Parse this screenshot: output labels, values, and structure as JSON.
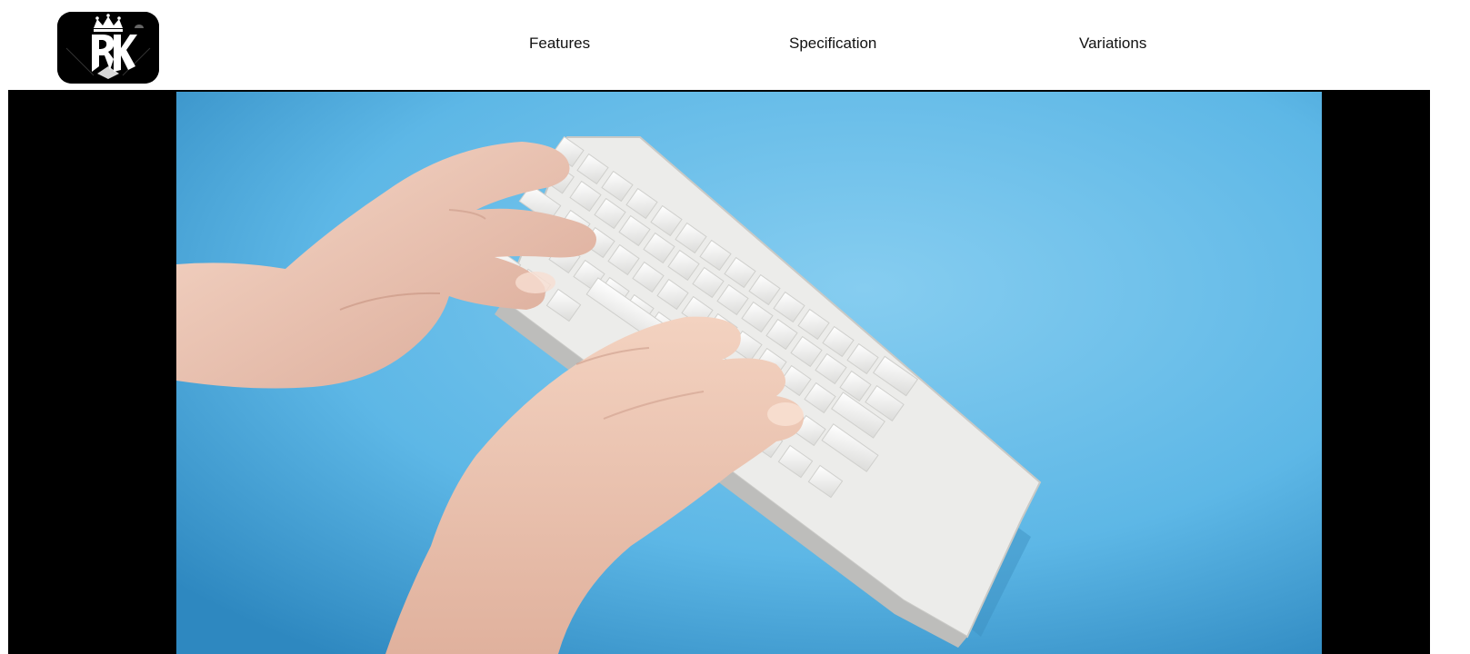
{
  "header": {
    "logo": {
      "text": "RK",
      "icon": "crown-rk-logo"
    },
    "nav": [
      {
        "label": "Features"
      },
      {
        "label": "Specification"
      },
      {
        "label": "Variations"
      }
    ]
  },
  "hero": {
    "media": "video",
    "scene": "hands-typing-on-white-mechanical-keyboard",
    "colors": {
      "background": "#6ec2ea",
      "letterbox": "#000000",
      "keycap": "#f4f4f2"
    }
  }
}
